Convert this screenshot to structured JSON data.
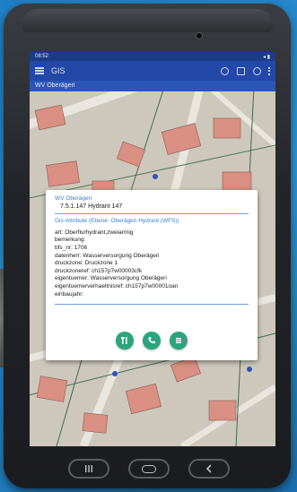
{
  "status_bar": {
    "time": "08:52",
    "right": "◂ ▮"
  },
  "app_bar": {
    "title": "GIS"
  },
  "sub_bar": {
    "title": "WV Oberägeri"
  },
  "popup": {
    "header1": "WV Oberägeri",
    "value1": "7.5.1.147 Hydrant 147",
    "header2": "Gis-Attribute (Ebene: Oberägeri Hydrant (WFS))",
    "attributes": [
      "art: Oberflurhydrant,zweiarmig",
      "bemerkung:",
      "bfs_nr: 1706",
      "datenherr: Wasserversorgung Oberägeri",
      "druckzone: Druckzone 1",
      "druckzoneref: ch157p7w00003cfk",
      "eigentuemer: Wasserversorgung Oberägeri",
      "eigentuemerverhaeltnisref: ch157p7w00001oan",
      "einbaujahr:"
    ],
    "buttons": [
      "tools-icon",
      "phone-icon",
      "list-icon"
    ]
  },
  "colors": {
    "appbar": "#2348a8",
    "accent": "#3c7fd0",
    "action": "#2aa57d"
  }
}
